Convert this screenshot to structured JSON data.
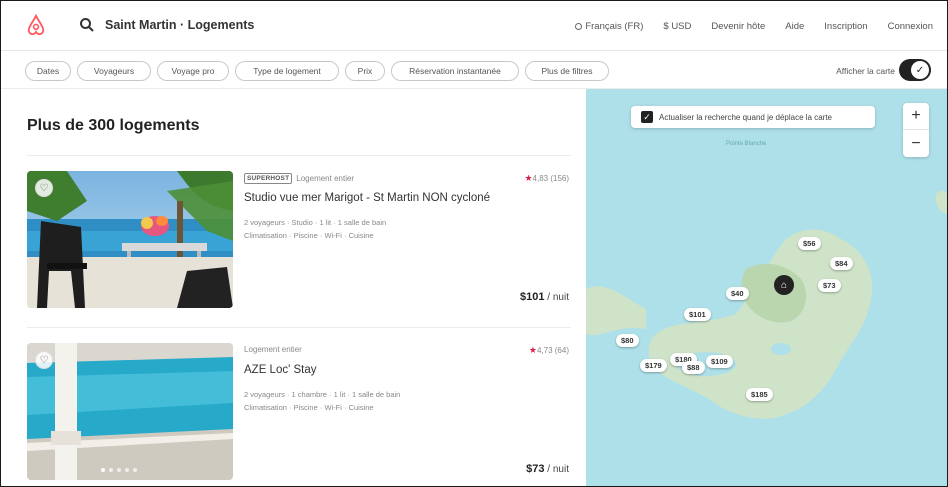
{
  "header": {
    "search_text": "Saint Martin · Logements",
    "nav": {
      "language": "Français (FR)",
      "currency": "$ USD",
      "host": "Devenir hôte",
      "help": "Aide",
      "signup": "Inscription",
      "login": "Connexion"
    }
  },
  "filters": {
    "chips": [
      "Dates",
      "Voyageurs",
      "Voyage pro",
      "Type de logement",
      "Prix",
      "Réservation instantanée",
      "Plus de filtres"
    ],
    "show_map_label": "Afficher la carte",
    "show_map_on": true
  },
  "results": {
    "title": "Plus de 300 logements",
    "listings": [
      {
        "superhost_badge": "SUPERHOST",
        "type": "Logement entier",
        "rating": "4,83 (156)",
        "name": "Studio vue mer Marigot - St Martin NON cycloné",
        "details_line1": "2 voyageurs · Studio · 1 lit · 1 salle de bain",
        "details_line2": "Climatisation · Piscine · Wi-Fi · Cuisine",
        "price": "$101",
        "price_unit": " / nuit"
      },
      {
        "superhost_badge": "",
        "type": "Logement entier",
        "rating": "4,73 (64)",
        "name": "AZE Loc' Stay",
        "details_line1": "2 voyageurs · 1 chambre · 1 lit · 1 salle de bain",
        "details_line2": "Climatisation · Piscine · Wi-Fi · Cuisine",
        "price": "$73",
        "price_unit": " / nuit"
      }
    ]
  },
  "map": {
    "update_checkbox_label": "Actualiser la recherche quand je déplace la carte",
    "zoom_in": "+",
    "zoom_out": "−",
    "sea_label": "Pointe Blanche",
    "price_pins": [
      "$56",
      "$84",
      "$40",
      "$73",
      "$101",
      "$80",
      "$179",
      "$180",
      "$88",
      "$109",
      "$185"
    ]
  },
  "colors": {
    "brand": "#ff5a5f",
    "water": "#aee0ea",
    "land": "#cfe3c8",
    "star": "#e01f4b"
  }
}
